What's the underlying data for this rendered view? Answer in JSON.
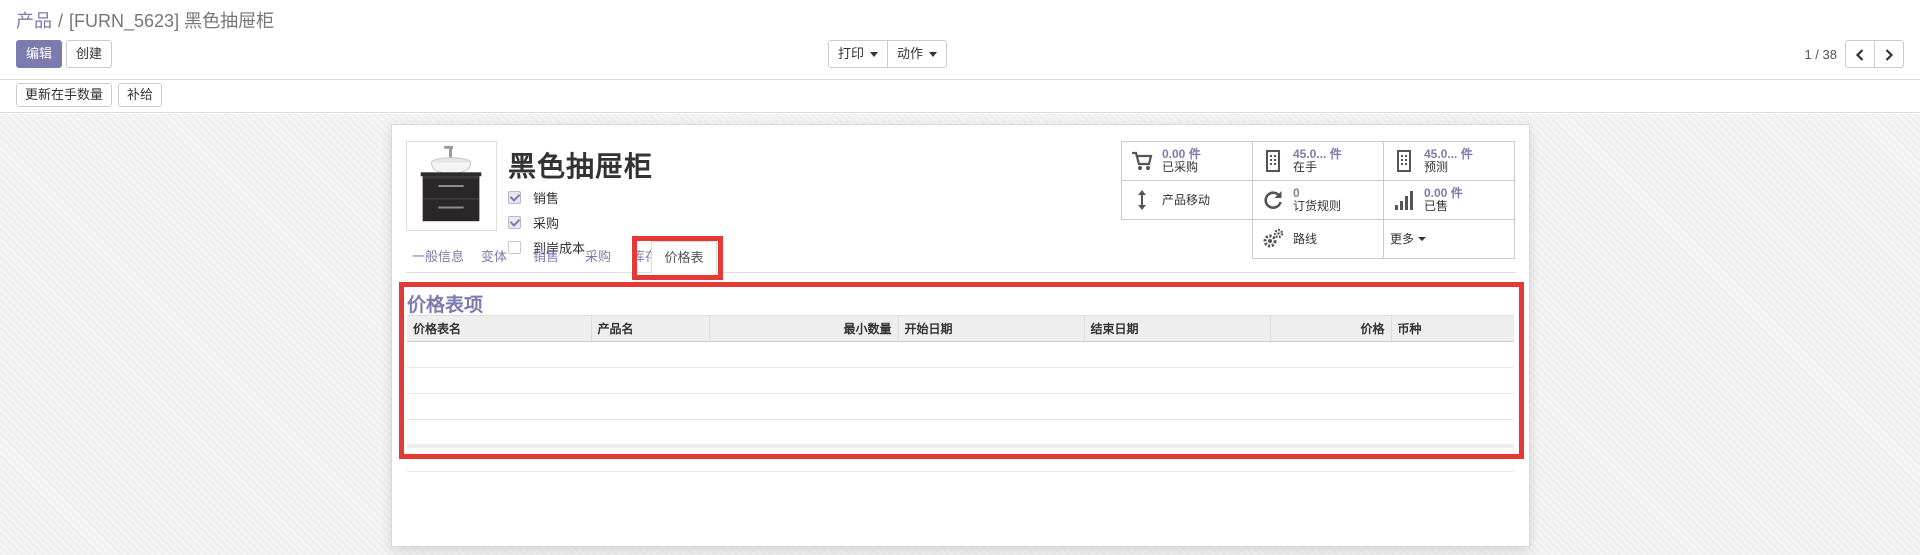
{
  "breadcrumb": {
    "parent": "产品",
    "separator": "/",
    "current": "[FURN_5623] 黑色抽屉柜"
  },
  "toolbar": {
    "edit_label": "编辑",
    "create_label": "创建",
    "print_label": "打印",
    "action_label": "动作"
  },
  "pager": {
    "value": "1 / 38",
    "prev_icon": "chevron-left-icon",
    "next_icon": "chevron-right-icon"
  },
  "statusbar": {
    "update_qty_label": "更新在手数量",
    "replenish_label": "补给"
  },
  "product": {
    "name": "黑色抽屉柜",
    "image_icon": "product-image",
    "checkboxes": [
      {
        "label": "销售",
        "checked": true
      },
      {
        "label": "采购",
        "checked": true
      },
      {
        "label": "到岸成本",
        "checked": false
      }
    ]
  },
  "smart_buttons": {
    "purchased": {
      "value": "0.00 件",
      "label": "已采购",
      "icon": "cart-icon"
    },
    "on_hand": {
      "value": "45.0... 件",
      "label": "在手",
      "icon": "building-icon"
    },
    "forecast": {
      "value": "45.0... 件",
      "label": "预测",
      "icon": "building-icon"
    },
    "moves": {
      "label": "产品移动",
      "icon": "vertical-arrows-icon"
    },
    "reorder": {
      "value": "0",
      "label": "订货规则",
      "icon": "refresh-icon"
    },
    "sold": {
      "value": "0.00 件",
      "label": "已售",
      "icon": "signal-icon"
    },
    "routes": {
      "label": "路线",
      "icon": "gears-icon"
    },
    "more": {
      "label": "更多"
    }
  },
  "tabs": [
    {
      "label": "一般信息",
      "active": false
    },
    {
      "label": "变体",
      "active": false
    },
    {
      "label": "销售",
      "active": false
    },
    {
      "label": "采购",
      "active": false
    },
    {
      "label": "库存",
      "active": false
    },
    {
      "label": "价格表",
      "active": true
    }
  ],
  "pricelist": {
    "title": "价格表项",
    "columns": [
      "价格表名",
      "产品名",
      "最小数量",
      "开始日期",
      "结束日期",
      "价格",
      "币种"
    ],
    "rows": []
  },
  "colors": {
    "accent": "#7c7bad",
    "highlight": "#e53935"
  }
}
